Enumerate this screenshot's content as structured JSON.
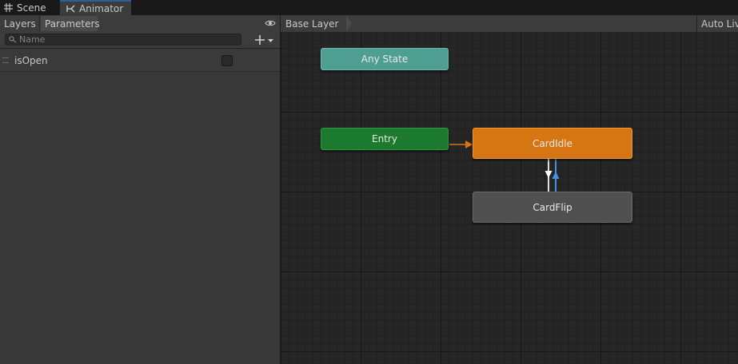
{
  "tabs": {
    "scene": {
      "label": "Scene",
      "icon": "grid-icon"
    },
    "animator": {
      "label": "Animator",
      "icon": "animator-icon"
    }
  },
  "left_panel": {
    "subtabs": {
      "layers": "Layers",
      "parameters": "Parameters"
    },
    "search": {
      "placeholder": "Name",
      "value": ""
    },
    "parameters": [
      {
        "name": "isOpen",
        "type": "bool",
        "checked": false
      }
    ]
  },
  "graph": {
    "breadcrumb": "Base Layer",
    "auto_live_label": "Auto Liv",
    "states": {
      "any_state": "Any State",
      "entry": "Entry",
      "idle": "CardIdle",
      "flip": "CardFlip"
    },
    "colors": {
      "any_state": "#4e9e91",
      "entry": "#1c7a2e",
      "default_state": "#d67613",
      "state": "#505050",
      "transition_selected": "#4a90e2"
    }
  }
}
